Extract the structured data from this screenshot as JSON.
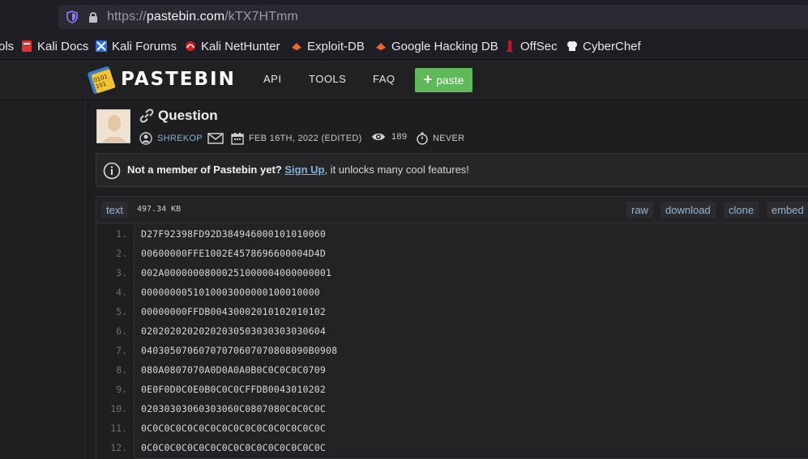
{
  "browser": {
    "url_scheme": "https://",
    "url_host": "pastebin.com",
    "url_path": "/kTX7HTmm",
    "bookmarks": [
      {
        "label": "ols",
        "icon": "tools-icon"
      },
      {
        "label": "Kali Docs",
        "icon": "kali-docs-icon"
      },
      {
        "label": "Kali Forums",
        "icon": "kali-forums-icon"
      },
      {
        "label": "Kali NetHunter",
        "icon": "kali-nethunter-icon"
      },
      {
        "label": "Exploit-DB",
        "icon": "exploit-db-icon"
      },
      {
        "label": "Google Hacking DB",
        "icon": "ghdb-icon"
      },
      {
        "label": "OffSec",
        "icon": "offsec-icon"
      },
      {
        "label": "CyberChef",
        "icon": "cyberchef-icon"
      }
    ]
  },
  "header": {
    "logo": "PASTEBIN",
    "nav": [
      "API",
      "TOOLS",
      "FAQ"
    ],
    "paste_button": "paste"
  },
  "paste": {
    "title": "Question",
    "author": "SHREKOP",
    "date": "FEB 16TH, 2022 (EDITED)",
    "views": "189",
    "expiry": "NEVER"
  },
  "notice": {
    "lead": "Not a member of Pastebin yet?",
    "link": "Sign Up",
    "tail": ", it unlocks many cool features!"
  },
  "code": {
    "syntax": "text",
    "size": "497.34 KB",
    "actions": [
      "raw",
      "download",
      "clone",
      "embed"
    ],
    "lines": [
      {
        "n": "1.",
        "text": "D27F92398FD92D384946000101010060"
      },
      {
        "n": "2.",
        "text": "00600000FFE1002E4578696600004D4D"
      },
      {
        "n": "3.",
        "text": "002A00000008000251000004000000001"
      },
      {
        "n": "4.",
        "text": "0000000051010003000000100010000"
      },
      {
        "n": "5.",
        "text": "00000000FFDB00430002010102010102"
      },
      {
        "n": "6.",
        "text": "02020202020202030503030303030604"
      },
      {
        "n": "7.",
        "text": "04030507060707070607070808090B0908"
      },
      {
        "n": "8.",
        "text": "080A0807070A0D0A0A0B0C0C0C0C0709"
      },
      {
        "n": "9.",
        "text": "0E0F0D0C0E0B0C0C0CFFDB0043010202"
      },
      {
        "n": "10.",
        "text": "02030303060303060C0807080C0C0C0C"
      },
      {
        "n": "11.",
        "text": "0C0C0C0C0C0C0C0C0C0C0C0C0C0C0C0C"
      },
      {
        "n": "12.",
        "text": "0C0C0C0C0C0C0C0C0C0C0C0C0C0C0C0C"
      }
    ]
  }
}
